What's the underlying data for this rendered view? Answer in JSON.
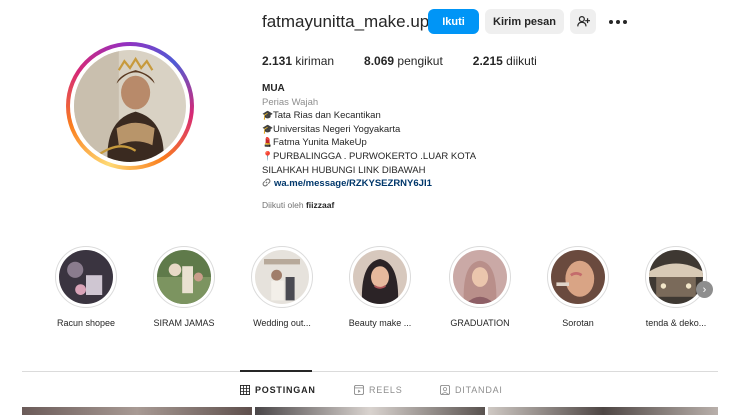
{
  "profile": {
    "username": "fatmayunitta_make.up",
    "follow_label": "Ikuti",
    "message_label": "Kirim pesan"
  },
  "stats": [
    {
      "value": "2.131",
      "label": "kiriman"
    },
    {
      "value": "8.069",
      "label": "pengikut"
    },
    {
      "value": "2.215",
      "label": "diikuti"
    }
  ],
  "bio": {
    "name": "MUA",
    "category": "Perias Wajah",
    "lines": [
      {
        "icon": "graduation-cap-icon",
        "glyph": "🎓",
        "text": "Tata Rias dan Kecantikan"
      },
      {
        "icon": "graduation-cap-icon",
        "glyph": "🎓",
        "text": "Universitas Negeri Yogyakarta"
      },
      {
        "icon": "lipstick-icon",
        "glyph": "💄",
        "text": "Fatma Yunita MakeUp"
      },
      {
        "icon": "pin-icon",
        "glyph": "📍",
        "text": "PURBALINGGA . PURWOKERTO .LUAR KOTA"
      },
      {
        "icon": "",
        "glyph": "",
        "text": "SILAHKAH HUBUNGI LINK DIBAWAH"
      }
    ],
    "link": "wa.me/message/RZKYSEZRNY6JI1"
  },
  "followed_by": {
    "prefix": "Diikuti oleh",
    "user": "fiizzaaf"
  },
  "highlights": [
    {
      "label": "Racun shopee"
    },
    {
      "label": "SIRAM JAMAS"
    },
    {
      "label": "Wedding out..."
    },
    {
      "label": "Beauty make ..."
    },
    {
      "label": "GRADUATION"
    },
    {
      "label": "Sorotan"
    },
    {
      "label": "tenda & deko..."
    }
  ],
  "tabs": [
    {
      "label": "POSTINGAN",
      "icon": "grid-icon",
      "active": true
    },
    {
      "label": "REELS",
      "icon": "reels-icon",
      "active": false
    },
    {
      "label": "DITANDAI",
      "icon": "tagged-icon",
      "active": false
    }
  ],
  "colors": {
    "accent": "#0095f6",
    "link": "#00376b",
    "muted": "#8e8e8e"
  }
}
